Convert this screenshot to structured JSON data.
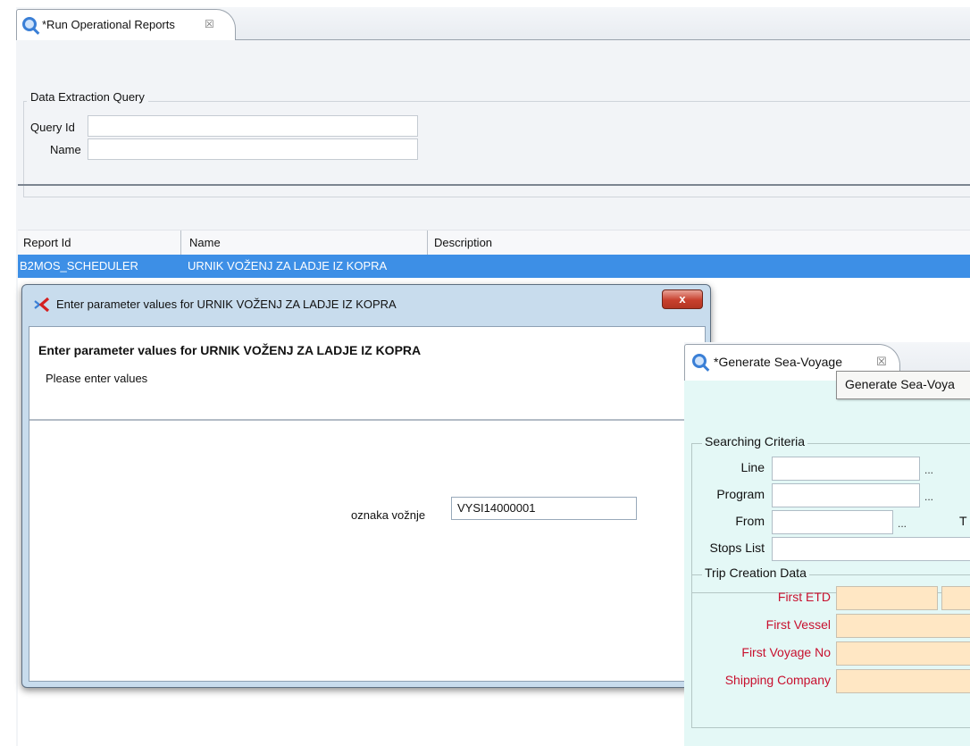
{
  "main_window": {
    "tab_title": "*Run Operational Reports",
    "tab_close": "☒",
    "group_title": "Data Extraction Query",
    "query_id_label": "Query Id",
    "name_label": "Name",
    "query_id_value": "",
    "name_value": "",
    "table": {
      "headers": [
        "Report Id",
        "Name",
        "Description"
      ],
      "selected_row": {
        "report_id": "B2MOS_SCHEDULER",
        "name": "URNIK VOŽENJ ZA LADJE IZ KOPRA",
        "description": ""
      }
    }
  },
  "dialog": {
    "title": "Enter parameter values for URNIK VOŽENJ ZA LADJE IZ KOPRA",
    "close_label": "x",
    "heading": "Enter parameter values for URNIK VOŽENJ ZA LADJE IZ KOPRA",
    "subtitle": "Please enter values",
    "param_label": "oznaka vožnje",
    "param_value": "VYSI14000001"
  },
  "sea_voyage": {
    "tab_title": "*Generate Sea-Voyage",
    "tab_close": "☒",
    "tooltip": "Generate Sea-Voya",
    "searching_criteria": {
      "title": "Searching Criteria",
      "line_label": "Line",
      "program_label": "Program",
      "from_label": "From",
      "to_label_partial": "T",
      "stops_list_label": "Stops List",
      "ellipsis": "..."
    },
    "trip_creation": {
      "title": "Trip Creation Data",
      "first_etd_label": "First ETD",
      "first_vessel_label": "First Vessel",
      "first_voyage_no_label": "First Voyage No",
      "shipping_company_label": "Shipping Company"
    }
  },
  "colors": {
    "selection": "#3d8fe6",
    "required_label": "#c8102e",
    "required_field": "#ffe7c4",
    "sea_background": "#e4f8f6"
  }
}
